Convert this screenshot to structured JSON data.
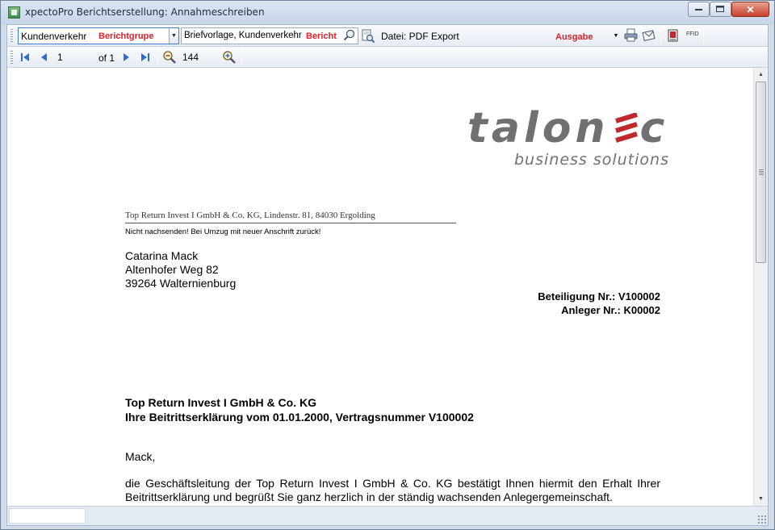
{
  "window": {
    "title": "xpectoPro Berichtserstellung: Annahmeschreiben",
    "close_glyph": "✕"
  },
  "toolbar": {
    "group_combo_value": "Kundenverkehr",
    "group_combo_tag": "Berichtgrupe",
    "report_combo_value": "Briefvorlage, Kundenverkehr",
    "report_combo_tag": "Bericht",
    "output_label": "Datei: PDF Export",
    "output_tag": "Ausgabe",
    "ffid_label": "FFID"
  },
  "navigation": {
    "current_page": "1",
    "page_total": "of 1",
    "zoom_value": "144"
  },
  "document": {
    "logo_text": "talon",
    "logo_text_end": "c",
    "logo_tagline": "business solutions",
    "sender_line": "Top Return Invest I GmbH & Co. KG, Lindenstr. 81, 84030 Ergolding",
    "postal_notice": "Nicht nachsenden! Bei Umzug mit neuer Anschrift zurück!",
    "recipient": {
      "name": "Catarina Mack",
      "street": "Altenhofer Weg 82",
      "city": "39264 Walternienburg"
    },
    "reference_participation": "Beteiligung Nr.: V100002",
    "reference_investor": "Anleger Nr.: K00002",
    "subject_company": "Top Return Invest I GmbH & Co. KG",
    "subject_line": "Ihre Beitrittserklärung vom 01.01.2000, Vertragsnummer V100002",
    "salutation": "Mack,",
    "body_paragraph": "die Geschäftsleitung der Top Return Invest I GmbH & Co. KG bestätigt Ihnen hiermit den Erhalt Ihrer Beitrittserklärung und begrüßt Sie ganz herzlich in der ständig wachsenden Anlegergemeinschaft."
  },
  "colors": {
    "tag_red": "#e0202a",
    "logo_red": "#c0282c",
    "logo_gray": "#707070"
  }
}
